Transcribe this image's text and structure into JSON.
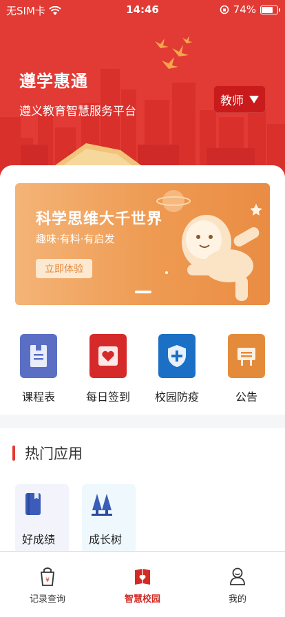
{
  "status_bar": {
    "carrier": "无SIM卡",
    "time": "14:46",
    "battery_percent": "74%",
    "battery_level": 0.74
  },
  "header": {
    "title": "遵学惠通",
    "subtitle": "遵义教育智慧服务平台",
    "role_label": "教师",
    "background_color": "#e23a34"
  },
  "banner": {
    "title": "科学思维大千世界",
    "subtitle": "趣味·有料·有启发",
    "button_label": "立即体验",
    "colors": [
      "#f4b477",
      "#ea8c43"
    ]
  },
  "quick_actions": [
    {
      "label": "课程表",
      "icon": "timetable-icon",
      "color": "#5a6fc4"
    },
    {
      "label": "每日签到",
      "icon": "daily-checkin-icon",
      "color": "#d62a2a"
    },
    {
      "label": "校园防疫",
      "icon": "campus-epidemic-shield-icon",
      "color": "#1b6fc4"
    },
    {
      "label": "公告",
      "icon": "notice-board-icon",
      "color": "#e48b3b"
    }
  ],
  "hot_apps": {
    "title": "热门应用",
    "items": [
      {
        "label": "好成绩",
        "icon": "report-book-icon",
        "color": "#f3f4fb"
      },
      {
        "label": "成长树",
        "icon": "growth-tree-icon",
        "color": "#eef8fd"
      }
    ]
  },
  "tab_bar": {
    "items": [
      {
        "label": "记录查询",
        "icon": "record-query-icon",
        "active": false
      },
      {
        "label": "智慧校园",
        "icon": "smart-campus-icon",
        "active": true
      },
      {
        "label": "我的",
        "icon": "profile-icon",
        "active": false
      }
    ],
    "active_color": "#d32a24"
  }
}
